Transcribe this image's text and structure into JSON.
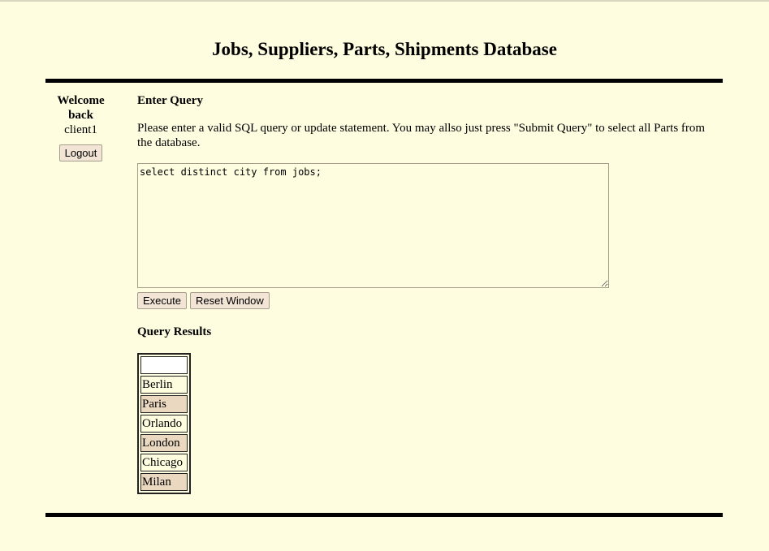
{
  "page": {
    "title": "Jobs, Suppliers, Parts, Shipments Database"
  },
  "sidebar": {
    "welcome_line1": "Welcome",
    "welcome_line2": "back",
    "username": "client1",
    "logout_label": "Logout"
  },
  "query": {
    "heading": "Enter Query",
    "instructions": "Please enter a valid SQL query or update statement. You may allso just press \"Submit Query\" to select all Parts from the database.",
    "value": "select distinct city from jobs;",
    "execute_label": "Execute",
    "reset_label": "Reset Window"
  },
  "results": {
    "heading": "Query Results",
    "column_header": "",
    "rows": [
      "Berlin",
      "Paris",
      "Orlando",
      "London",
      "Chicago",
      "Milan"
    ]
  }
}
